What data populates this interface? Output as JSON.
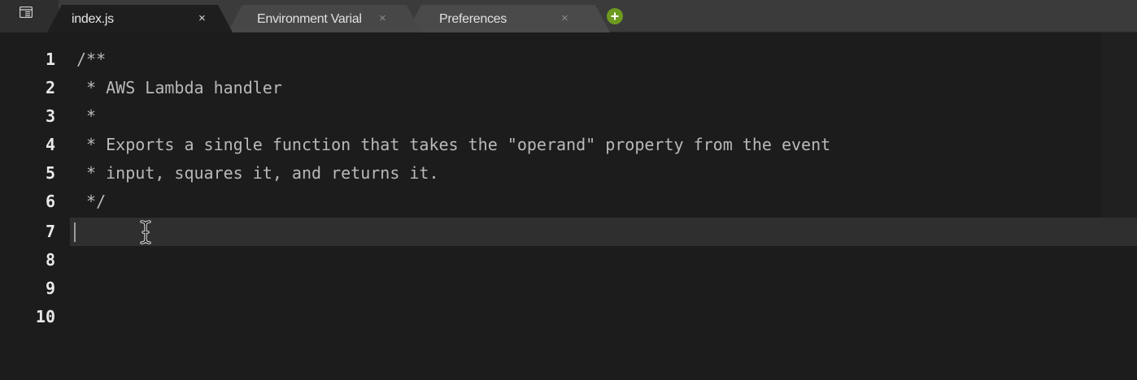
{
  "colors": {
    "tabbar_bg": "#3b3b3b",
    "active_tab_bg": "#1e1e1e",
    "inactive_tab_bg": "#4a4a4a",
    "editor_bg": "#1c1c1c",
    "active_line_bg": "#2f2f2f",
    "comment_text": "#b9b9b9",
    "line_number_text": "#e8e8e8",
    "new_tab_button": "#6d9a1f"
  },
  "tabbar": {
    "menu_icon": "panel-menu-icon",
    "tabs": [
      {
        "label": "index.js",
        "close_glyph": "×",
        "active": true
      },
      {
        "label": "Environment Variables",
        "close_glyph": "×",
        "active": false
      },
      {
        "label": "Preferences",
        "close_glyph": "×",
        "active": false
      }
    ],
    "new_tab_icon": "plus-circle-icon"
  },
  "editor": {
    "active_line": 7,
    "lines": [
      {
        "number": "1",
        "text": "/**"
      },
      {
        "number": "2",
        "text": " * AWS Lambda handler"
      },
      {
        "number": "3",
        "text": " *"
      },
      {
        "number": "4",
        "text": " * Exports a single function that takes the \"operand\" property from the event"
      },
      {
        "number": "5",
        "text": " * input, squares it, and returns it."
      },
      {
        "number": "6",
        "text": " */"
      },
      {
        "number": "7",
        "text": ""
      },
      {
        "number": "8",
        "text": ""
      },
      {
        "number": "9",
        "text": ""
      },
      {
        "number": "10",
        "text": ""
      }
    ],
    "pointer_icon": "ibeam-cursor-icon"
  }
}
